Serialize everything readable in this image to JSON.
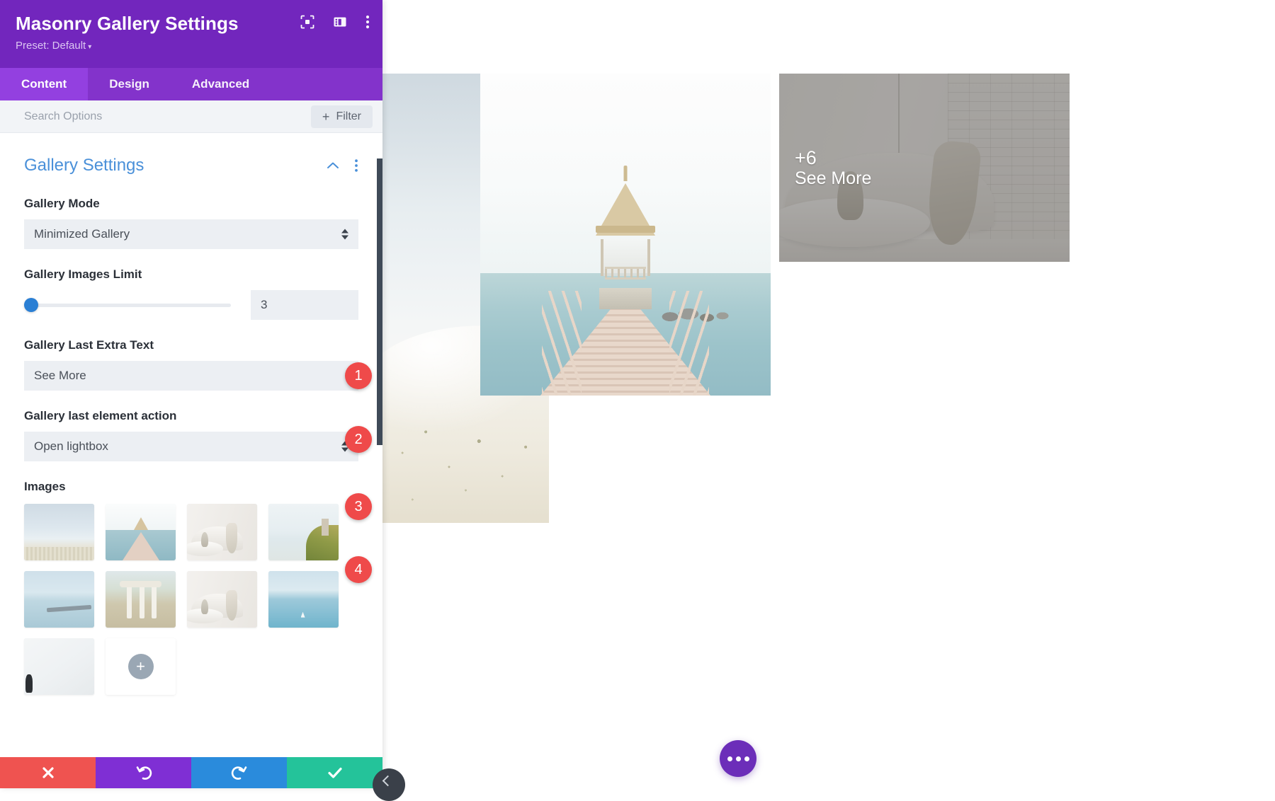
{
  "panel": {
    "title": "Masonry Gallery Settings",
    "preset_label": "Preset: Default",
    "preset_caret": "▾",
    "header_icons": [
      {
        "name": "focus-target-icon"
      },
      {
        "name": "layout-panel-icon"
      },
      {
        "name": "kebab-menu-icon"
      }
    ],
    "tabs": [
      {
        "label": "Content",
        "active": true
      },
      {
        "label": "Design",
        "active": false
      },
      {
        "label": "Advanced",
        "active": false
      }
    ],
    "search": {
      "placeholder": "Search Options",
      "value": "",
      "filter_label": "Filter",
      "filter_plus": "+"
    },
    "section": {
      "title": "Gallery Settings",
      "collapse_icon": "chevron-up-icon",
      "menu_icon": "kebab-menu-icon"
    },
    "fields": {
      "gallery_mode": {
        "label": "Gallery Mode",
        "value": "Minimized Gallery",
        "marker": "1"
      },
      "gallery_images_limit": {
        "label": "Gallery Images Limit",
        "value": "3",
        "slider_percent": 0,
        "marker": "2"
      },
      "gallery_last_extra_text": {
        "label": "Gallery Last Extra Text",
        "value": "See More",
        "marker": "3"
      },
      "gallery_last_element_action": {
        "label": "Gallery last element action",
        "value": "Open lightbox",
        "marker": "4"
      },
      "images": {
        "label": "Images",
        "add_label": "+",
        "thumbs": [
          {
            "name": "thumb-beach-horizon",
            "art": "t-beach"
          },
          {
            "name": "thumb-pier-gazebo",
            "art": "t-pier"
          },
          {
            "name": "thumb-white-interior",
            "art": "t-room"
          },
          {
            "name": "thumb-cliff-overlook",
            "art": "t-cliff"
          },
          {
            "name": "thumb-calm-jetty",
            "art": "t-jetty"
          },
          {
            "name": "thumb-white-archway",
            "art": "t-arch"
          },
          {
            "name": "thumb-white-sofa-room",
            "art": "t-room"
          },
          {
            "name": "thumb-blue-sea-sailboat",
            "art": "t-sea"
          },
          {
            "name": "thumb-white-minimal",
            "art": "t-white"
          }
        ]
      }
    },
    "actions": [
      {
        "name": "cancel-button",
        "icon": "close-x-icon",
        "class": "act-cancel"
      },
      {
        "name": "undo-button",
        "icon": "undo-arrow-icon",
        "class": "act-undo"
      },
      {
        "name": "redo-button",
        "icon": "redo-arrow-icon",
        "class": "act-redo"
      },
      {
        "name": "save-button",
        "icon": "checkmark-icon",
        "class": "act-save"
      }
    ]
  },
  "canvas": {
    "gallery": {
      "items": [
        {
          "name": "gallery-image-dune-beach"
        },
        {
          "name": "gallery-image-pier-gazebo"
        },
        {
          "name": "gallery-image-interior-see-more"
        }
      ],
      "overlay": {
        "count": "+6",
        "label": "See More"
      }
    },
    "fab": {
      "name": "page-settings-fab",
      "icon": "ellipsis-icon"
    }
  },
  "colors": {
    "header_purple": "#7226BD",
    "tab_bar_purple": "#8333CB",
    "tab_active_purple": "#9340E0",
    "section_blue": "#4A90D9",
    "marker_red": "#EF4A4A",
    "slider_blue": "#2A7FD4",
    "cancel_red": "#EF5350",
    "undo_purple": "#7F2FD4",
    "redo_blue": "#2A8BDC",
    "save_teal": "#24C39A",
    "fab_purple": "#6C2EB9"
  }
}
